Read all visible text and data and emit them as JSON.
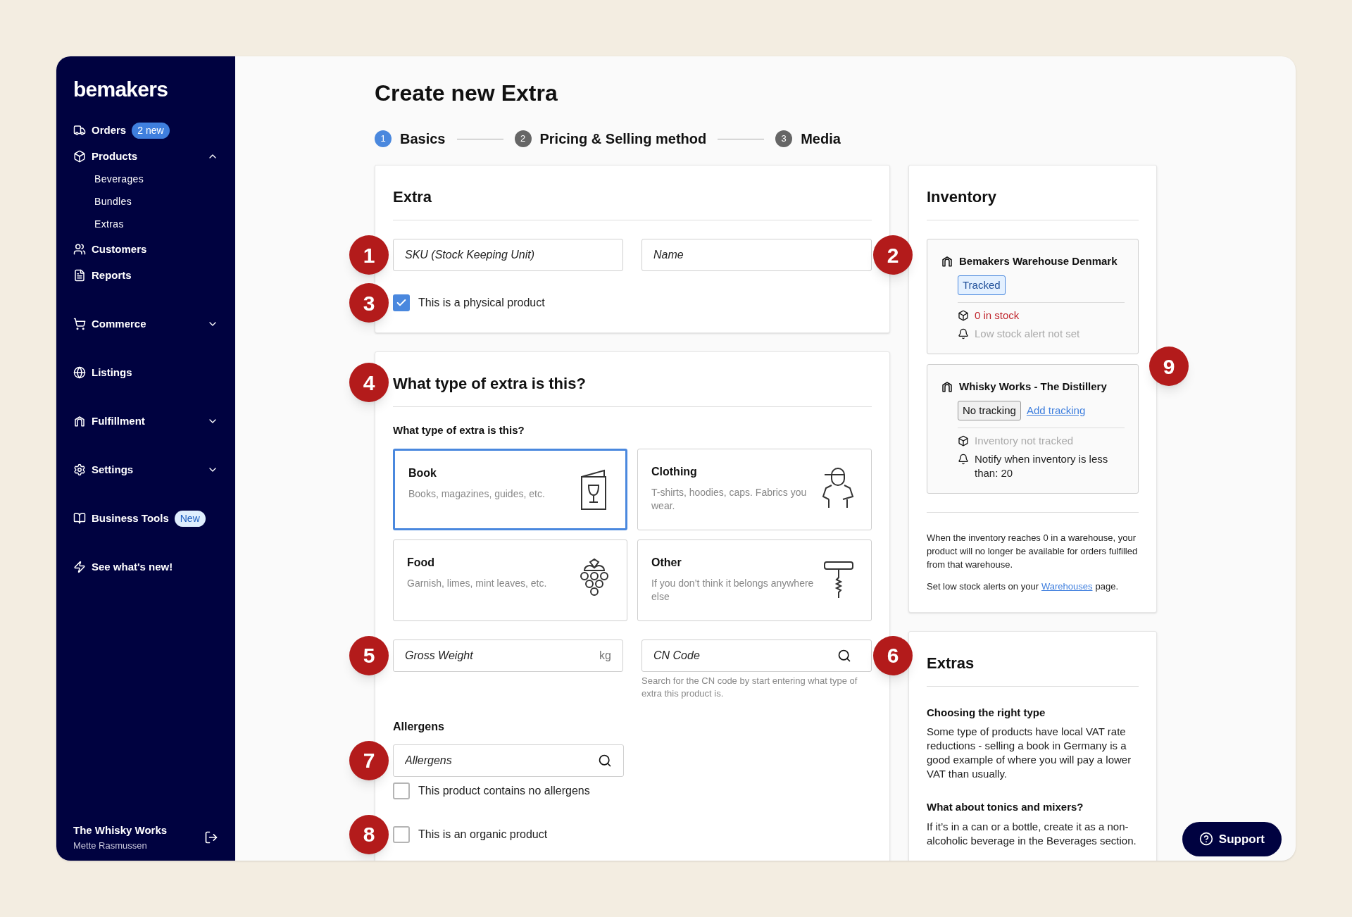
{
  "sidebar": {
    "logo": "bemakers",
    "items": [
      {
        "label": "Orders",
        "badge": {
          "text": "2 new",
          "kind": "solid"
        }
      },
      {
        "label": "Products",
        "expanded": true,
        "children": [
          {
            "label": "Beverages"
          },
          {
            "label": "Bundles"
          },
          {
            "label": "Extras"
          }
        ]
      },
      {
        "label": "Customers"
      },
      {
        "label": "Reports"
      },
      {
        "label": "Commerce",
        "expanded": false
      },
      {
        "label": "Listings"
      },
      {
        "label": "Fulfillment",
        "expanded": false
      },
      {
        "label": "Settings",
        "expanded": false
      },
      {
        "label": "Business Tools",
        "badge": {
          "text": "New",
          "kind": "soft"
        }
      },
      {
        "label": "See what's new!"
      }
    ],
    "account": {
      "name": "The Whisky Works",
      "user": "Mette Rasmussen"
    }
  },
  "page": {
    "title": "Create new Extra",
    "steps": [
      {
        "number": "1",
        "label": "Basics",
        "selected": true
      },
      {
        "number": "2",
        "label": "Pricing & Selling method",
        "selected": false
      },
      {
        "number": "3",
        "label": "Media",
        "selected": false
      }
    ]
  },
  "extra_card": {
    "title": "Extra",
    "sku": {
      "placeholder": "SKU (Stock Keeping Unit)"
    },
    "name": {
      "placeholder": "Name"
    },
    "physical": {
      "label": "This is a physical product",
      "checked": true
    }
  },
  "type_card": {
    "title": "What type of extra is this?",
    "question": "What type of extra is this?",
    "options": [
      {
        "title": "Book",
        "description": "Books, magazines, guides, etc.",
        "selected": true
      },
      {
        "title": "Clothing",
        "description": "T-shirts, hoodies, caps. Fabrics you wear.",
        "selected": false
      },
      {
        "title": "Food",
        "description": "Garnish, limes, mint leaves, etc.",
        "selected": false
      },
      {
        "title": "Other",
        "description": "If you don’t think it belongs anywhere else",
        "selected": false
      }
    ],
    "weight": {
      "placeholder": "Gross Weight",
      "unit": "kg"
    },
    "cn_code": {
      "placeholder": "CN Code",
      "help": "Search for the CN code by start entering what type of extra this product is."
    },
    "allergens_label": "Allergens",
    "allergens": {
      "placeholder": "Allergens"
    },
    "no_allergens": {
      "label": "This product contains no allergens",
      "checked": false
    },
    "organic": {
      "label": "This is an organic product",
      "checked": false
    }
  },
  "inventory": {
    "title": "Inventory",
    "warehouses": [
      {
        "name": "Bemakers Warehouse Denmark",
        "status": "Tracked",
        "tracked": true,
        "lines": [
          {
            "kind": "stock",
            "text": "0 in stock",
            "color": "#c0262d"
          },
          {
            "kind": "alert",
            "text": "Low stock alert not set",
            "color": "#aaaaaa"
          }
        ]
      },
      {
        "name": "Whisky Works - The Distillery",
        "status": "No tracking",
        "tracked": false,
        "action": "Add tracking",
        "lines": [
          {
            "kind": "stock",
            "text": "Inventory not tracked",
            "color": "#aaaaaa"
          },
          {
            "kind": "alert",
            "text": "Notify when inventory is less than: 20",
            "color": "#222222"
          }
        ]
      }
    ],
    "note": "When the inventory reaches 0 in a warehouse, your product will no longer be available for orders fulfilled from that warehouse.",
    "hint_before": "Set low stock alerts on your",
    "hint_link": "Warehouses",
    "hint_after": "page."
  },
  "extras_help": {
    "title": "Extras",
    "sections": [
      {
        "heading": "Choosing the right type",
        "text": "Some type of products have local VAT rate reductions - selling a book in Germany is a good example of where you will pay a lower VAT than usually."
      },
      {
        "heading": "What about tonics and mixers?",
        "text": "If it’s in a can or a bottle, create it as a non-alcoholic beverage in the Beverages section."
      }
    ]
  },
  "support": {
    "label": "Support"
  },
  "markers": [
    "1",
    "2",
    "3",
    "4",
    "5",
    "6",
    "7",
    "8",
    "9"
  ]
}
